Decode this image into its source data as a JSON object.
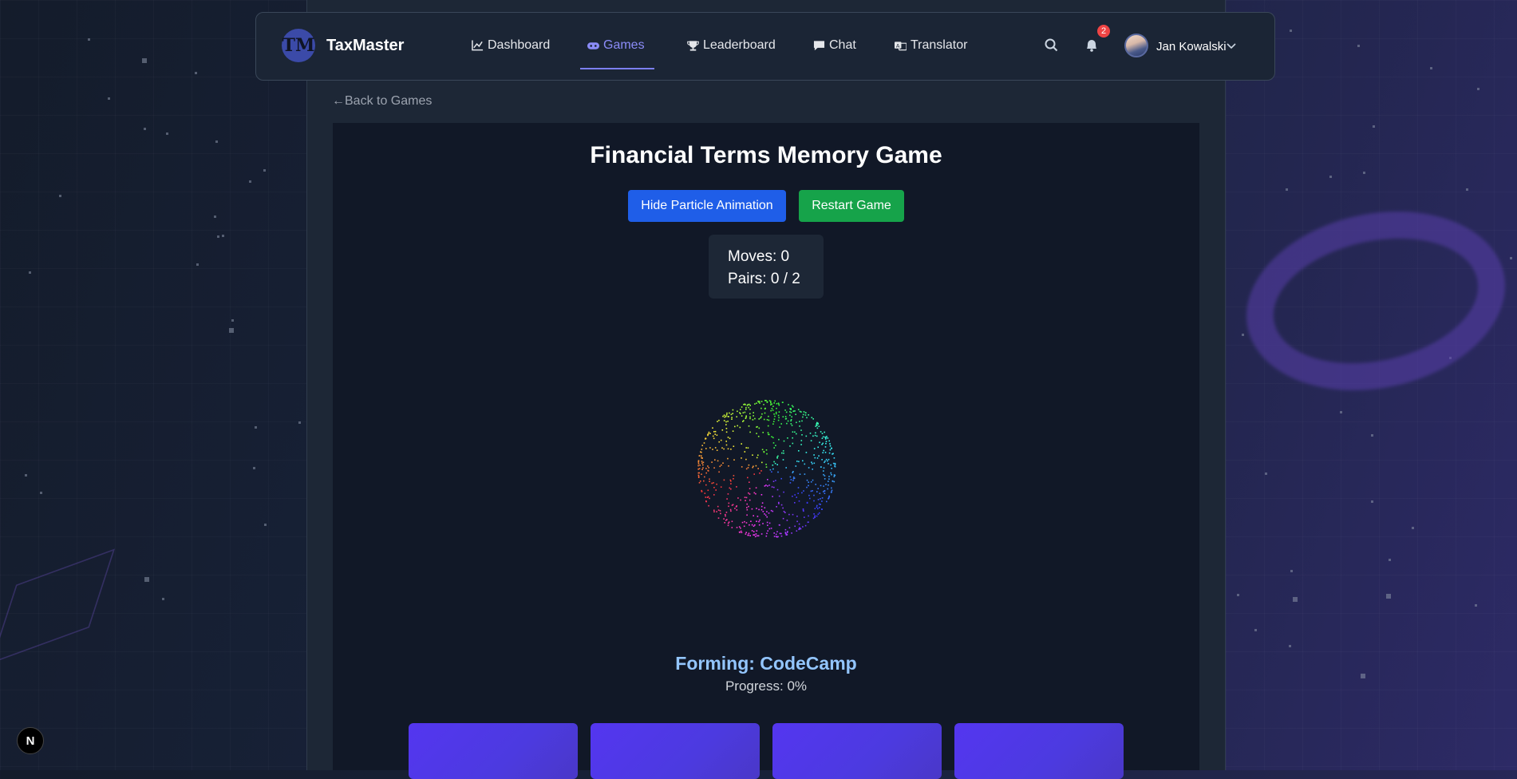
{
  "nav": {
    "brand": "TaxMaster",
    "logo_text": "TM",
    "items": [
      {
        "label": "Dashboard",
        "icon": "chart-icon"
      },
      {
        "label": "Games",
        "icon": "gamepad-icon",
        "active": true
      },
      {
        "label": "Leaderboard",
        "icon": "trophy-icon"
      },
      {
        "label": "Chat",
        "icon": "chat-icon"
      },
      {
        "label": "Translator",
        "icon": "translate-icon"
      }
    ],
    "notification_count": "2",
    "user_name": "Jan Kowalski"
  },
  "back_link": "←Back to Games",
  "game": {
    "title": "Financial Terms Memory Game",
    "hide_animation_label": "Hide Particle Animation",
    "restart_label": "Restart Game",
    "moves": "Moves: 0",
    "pairs": "Pairs: 0 / 2",
    "forming": "Forming: CodeCamp",
    "progress": "Progress: 0%",
    "progress_value": 0,
    "card_count": 4
  },
  "dev_badge": "N",
  "colors": {
    "accent": "#7c7ff2",
    "blue_button": "#1f5ee8",
    "green_button": "#16a34a",
    "card": "#5436f0",
    "forming_text": "#93c5fd"
  }
}
